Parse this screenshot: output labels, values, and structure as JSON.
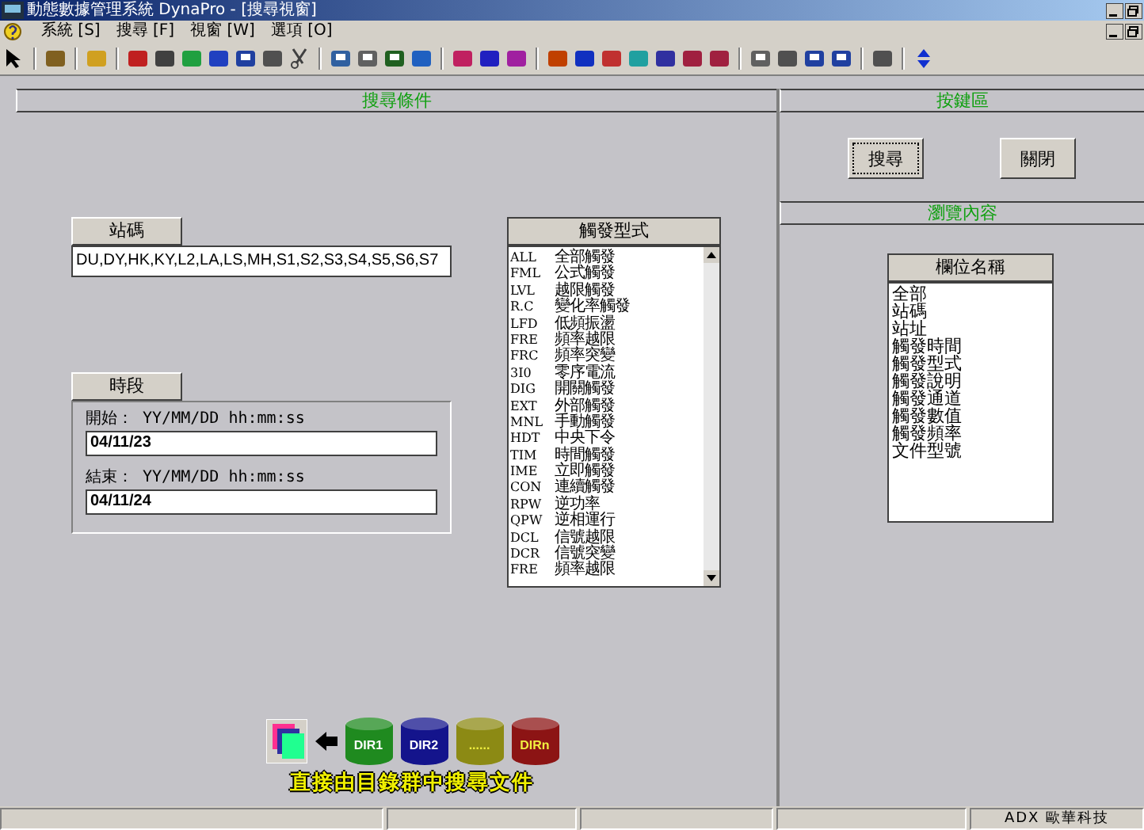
{
  "window": {
    "title": "動態數據管理系統 DynaPro - [搜尋視窗]"
  },
  "menu": [
    "系統 [S]",
    "搜尋 [F]",
    "視窗 [W]",
    "選項 [O]"
  ],
  "search_panel": {
    "header": "搜尋條件",
    "station": {
      "label": "站碼",
      "value": "DU,DY,HK,KY,L2,LA,LS,MH,S1,S2,S3,S4,S5,S6,S7"
    },
    "period": {
      "label": "時段",
      "start_label": "開始： YY/MM/DD hh:mm:ss",
      "start_value": "04/11/23",
      "end_label": "結束： YY/MM/DD hh:mm:ss",
      "end_value": "04/11/24"
    },
    "trigger_types": {
      "header": "觸發型式",
      "items": [
        {
          "code": "ALL",
          "label": "全部觸發"
        },
        {
          "code": "FML",
          "label": "公式觸發"
        },
        {
          "code": "LVL",
          "label": "越限觸發"
        },
        {
          "code": "R.C",
          "label": "變化率觸發"
        },
        {
          "code": "LFD",
          "label": "低頻振盪"
        },
        {
          "code": "FRE",
          "label": "頻率越限"
        },
        {
          "code": "FRC",
          "label": "頻率突變"
        },
        {
          "code": "3I0",
          "label": "零序電流"
        },
        {
          "code": "DIG",
          "label": "開關觸發"
        },
        {
          "code": "EXT",
          "label": "外部觸發"
        },
        {
          "code": "MNL",
          "label": "手動觸發"
        },
        {
          "code": "HDT",
          "label": "中央下令"
        },
        {
          "code": "TIM",
          "label": "時間觸發"
        },
        {
          "code": "IME",
          "label": "立即觸發"
        },
        {
          "code": "CON",
          "label": "連續觸發"
        },
        {
          "code": "RPW",
          "label": "逆功率"
        },
        {
          "code": "QPW",
          "label": "逆相運行"
        },
        {
          "code": "DCL",
          "label": "信號越限"
        },
        {
          "code": "DCR",
          "label": "信號突變"
        },
        {
          "code": "FRE",
          "label": "頻率越限"
        }
      ]
    },
    "directories": [
      {
        "label": "DIR1",
        "color": "#1f8a1f"
      },
      {
        "label": "DIR2",
        "color": "#14148c"
      },
      {
        "label": "......",
        "color": "#8c8a14"
      },
      {
        "label": "DIRn",
        "color": "#8c1414"
      }
    ],
    "directories_caption": "直接由目錄群中搜尋文件"
  },
  "button_panel": {
    "header": "按鍵區",
    "buttons": [
      {
        "label": "搜尋",
        "focused": true
      },
      {
        "label": "關閉",
        "focused": false
      }
    ]
  },
  "browse_panel": {
    "header": "瀏覽內容",
    "fields": {
      "header": "欄位名稱",
      "items": [
        "全部",
        "站碼",
        "站址",
        "觸發時間",
        "觸發型式",
        "觸發說明",
        "觸發通道",
        "觸發數值",
        "觸發頻率",
        "文件型號"
      ]
    }
  },
  "status_bar": {
    "right_text": "ADX 歐華科技"
  }
}
